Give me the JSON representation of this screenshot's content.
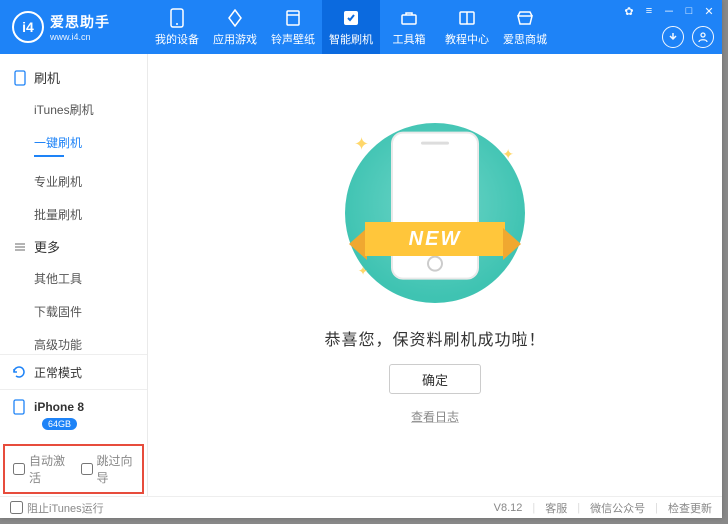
{
  "brand": {
    "name": "爱思助手",
    "url": "www.i4.cn",
    "logo_letters": "i4"
  },
  "tabs": [
    {
      "label": "我的设备",
      "icon": "phone"
    },
    {
      "label": "应用游戏",
      "icon": "apps"
    },
    {
      "label": "铃声壁纸",
      "icon": "music"
    },
    {
      "label": "智能刷机",
      "icon": "flash",
      "active": true
    },
    {
      "label": "工具箱",
      "icon": "toolbox"
    },
    {
      "label": "教程中心",
      "icon": "book"
    },
    {
      "label": "爱思商城",
      "icon": "store"
    }
  ],
  "window_controls": {
    "items": [
      "shirt",
      "menu",
      "min",
      "max",
      "close"
    ]
  },
  "title_right": {
    "download": "download",
    "user": "user"
  },
  "sidebar": {
    "groups": [
      {
        "title": "刷机",
        "icon": "phone",
        "items": [
          {
            "label": "iTunes刷机"
          },
          {
            "label": "一键刷机",
            "active": true
          },
          {
            "label": "专业刷机"
          },
          {
            "label": "批量刷机"
          }
        ]
      },
      {
        "title": "更多",
        "icon": "more",
        "items": [
          {
            "label": "其他工具"
          },
          {
            "label": "下载固件"
          },
          {
            "label": "高级功能"
          }
        ]
      }
    ],
    "status_card": {
      "label": "正常模式",
      "icon": "refresh"
    },
    "device_card": {
      "name": "iPhone 8",
      "storage": "64GB",
      "icon": "phone"
    },
    "checks": {
      "auto_activate": "自动激活",
      "skip_guide": "跳过向导"
    }
  },
  "main": {
    "ribbon_text": "NEW",
    "message": "恭喜您，保资料刷机成功啦！",
    "ok": "确定",
    "log_link": "查看日志"
  },
  "statusbar": {
    "block_itunes": "阻止iTunes运行",
    "version": "V8.12",
    "support": "客服",
    "wechat": "微信公众号",
    "update": "检查更新"
  },
  "colors": {
    "primary": "#1e83f7"
  }
}
